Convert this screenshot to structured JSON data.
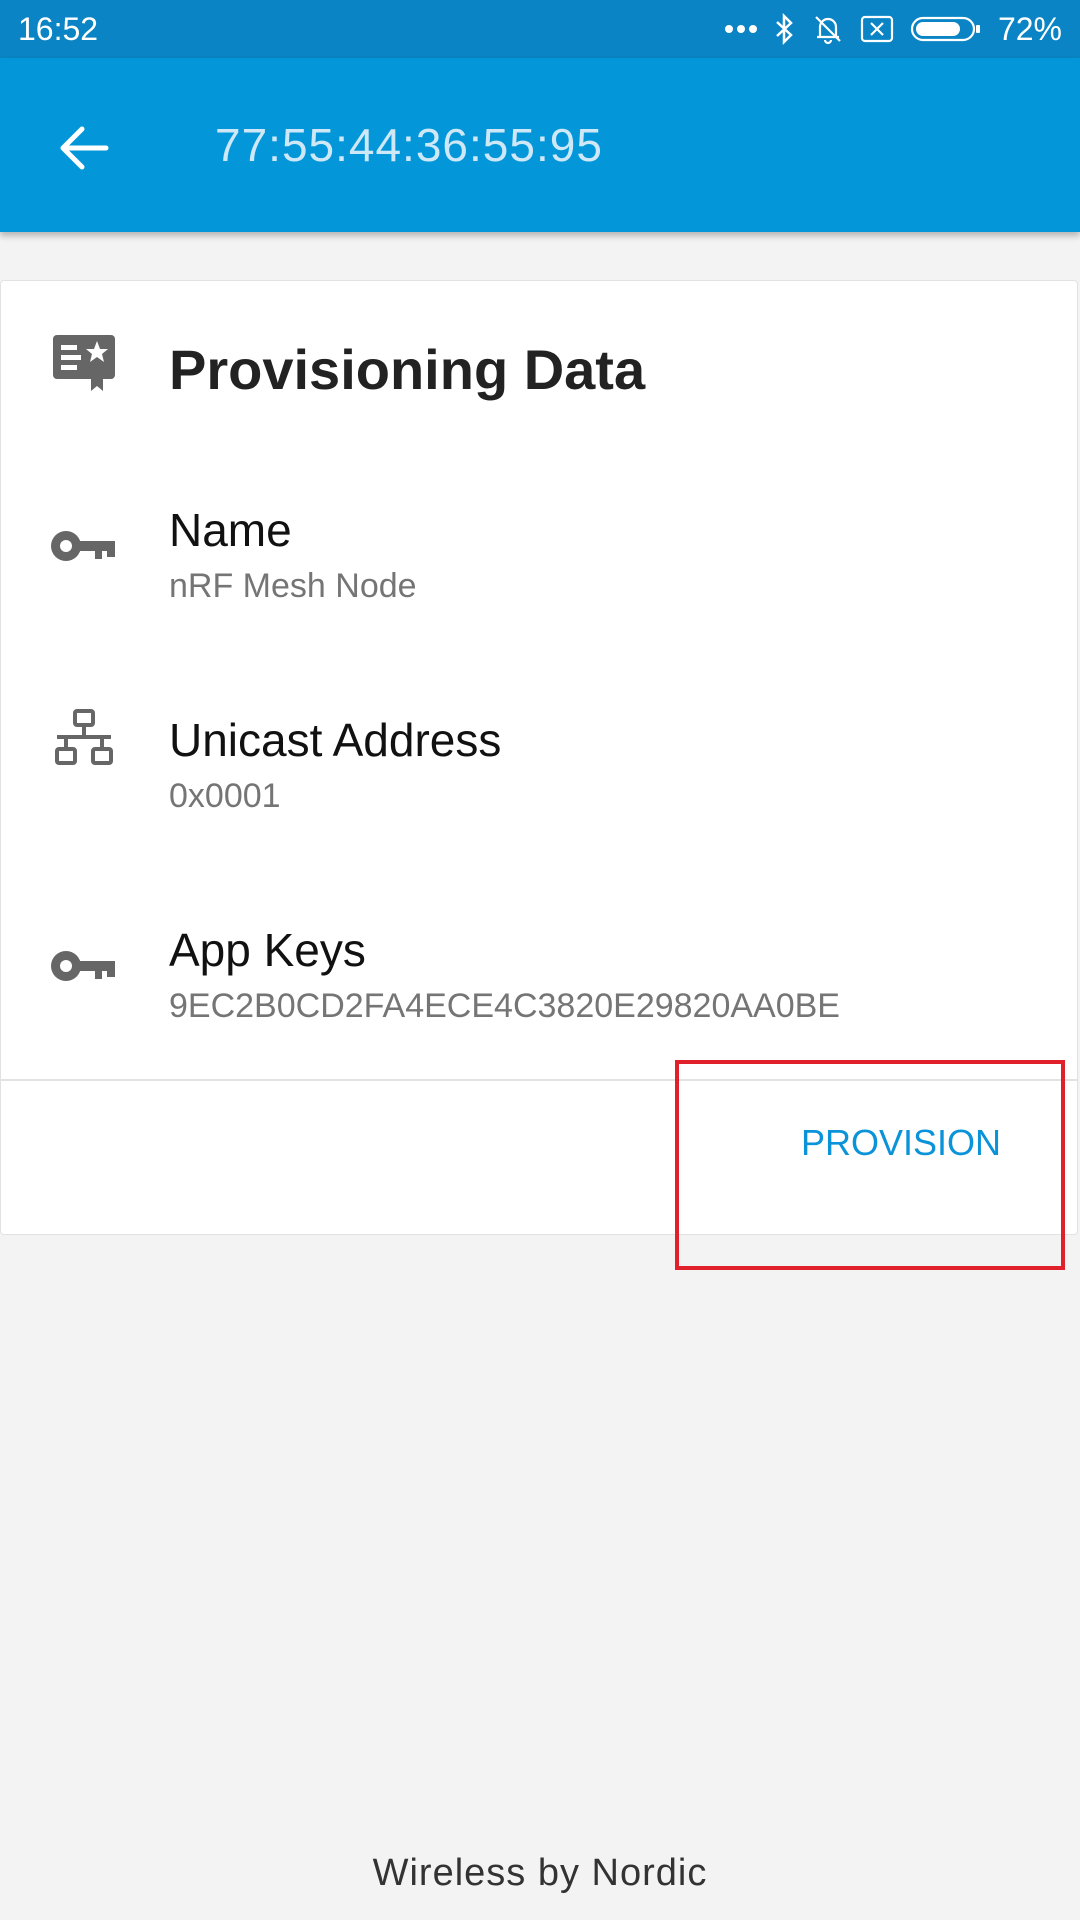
{
  "status_bar": {
    "time": "16:52",
    "battery_percent": "72%",
    "battery_level": 0.72,
    "icons": [
      "more-dots-icon",
      "bluetooth-icon",
      "notifications-off-icon",
      "sim-off-icon",
      "battery-icon"
    ]
  },
  "app_bar": {
    "title": "77:55:44:36:55:95",
    "back_icon": "arrow-back-icon"
  },
  "card": {
    "header_icon": "certificate-icon",
    "title": "Provisioning Data",
    "rows": [
      {
        "icon": "key-icon",
        "label": "Name",
        "value": "nRF Mesh Node"
      },
      {
        "icon": "network-icon",
        "label": "Unicast Address",
        "value": "0x0001"
      },
      {
        "icon": "key-icon",
        "label": "App Keys",
        "value": "9EC2B0CD2FA4ECE4C3820E29820AA0BE"
      }
    ],
    "action_label": "PROVISION"
  },
  "footer": {
    "text": "Wireless by Nordic"
  },
  "colors": {
    "status_bar": "#0a84c4",
    "app_bar": "#0397da",
    "accent": "#0a93d8",
    "highlight": "#e0202a",
    "background": "#f3f3f3"
  }
}
